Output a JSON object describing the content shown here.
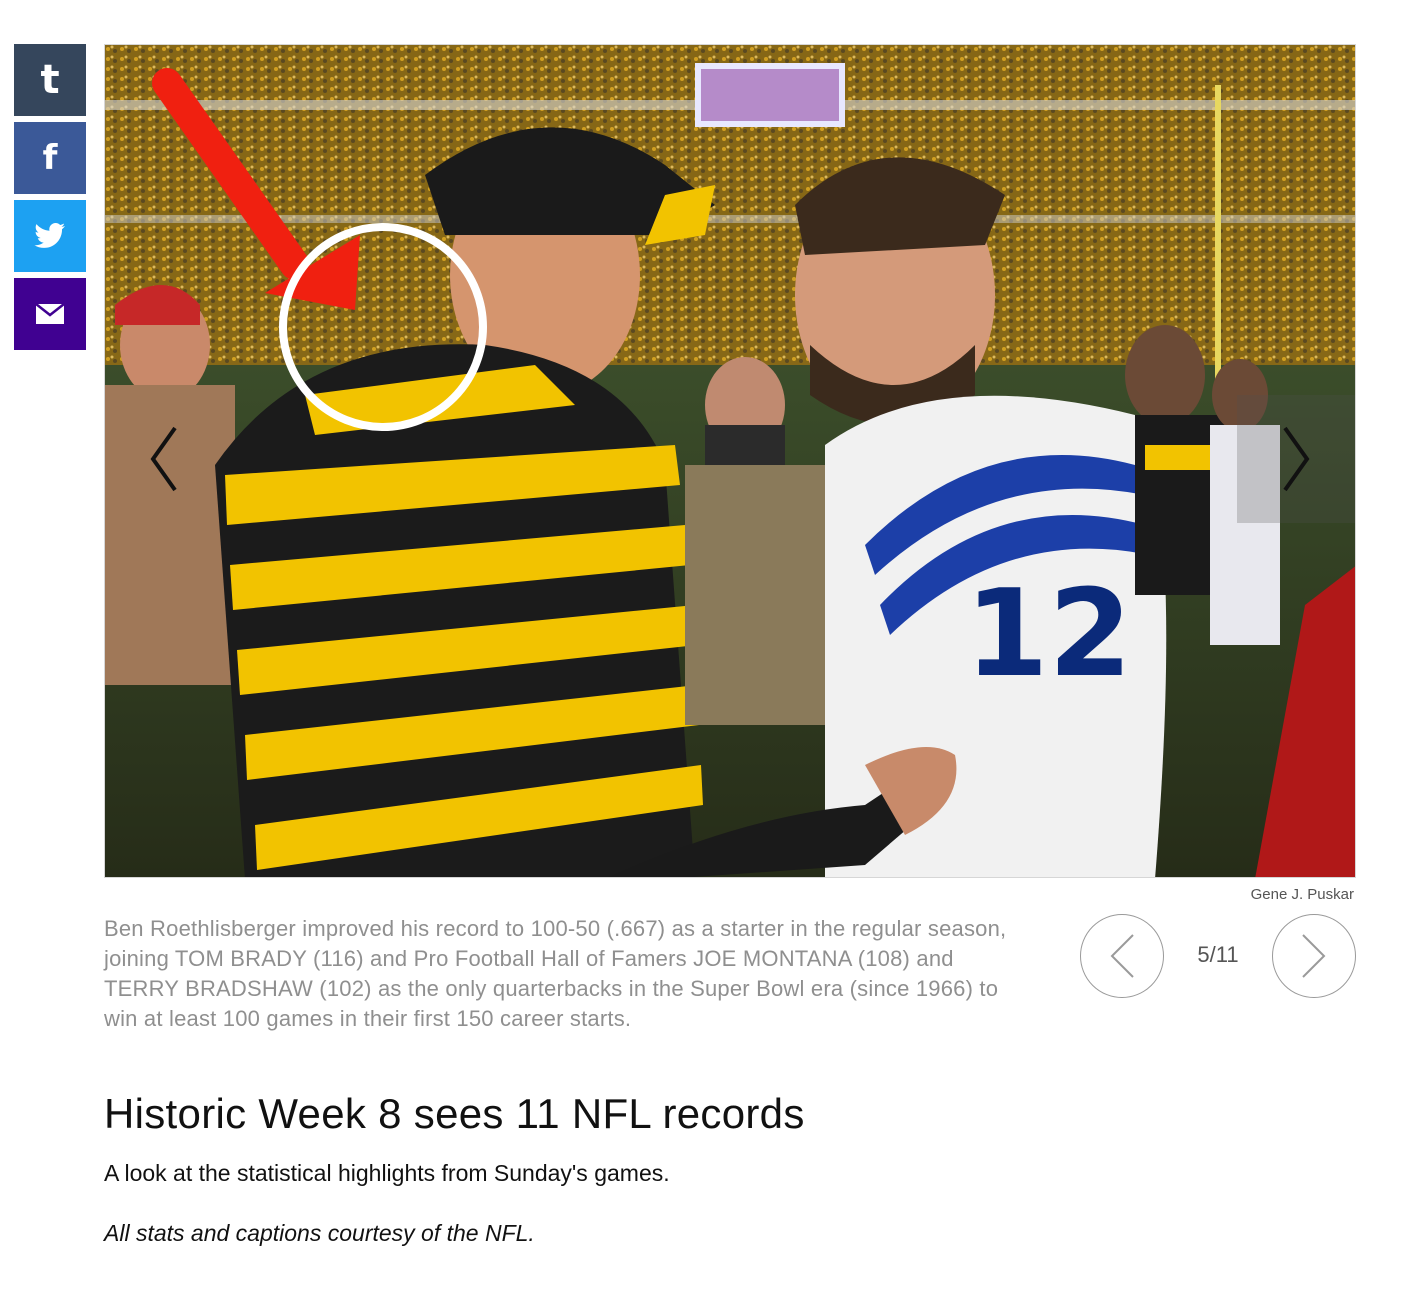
{
  "share": {
    "tumblr_glyph": "t",
    "facebook_glyph": "f",
    "twitter_icon": "twitter-bird-icon",
    "email_icon": "envelope-icon",
    "colors": {
      "tumblr": "#35465c",
      "facebook": "#3b5998",
      "twitter": "#1da1f2",
      "email": "#400191"
    }
  },
  "slideshow": {
    "photo_credit": "Gene J. Puskar",
    "jersey_number": "12",
    "prev_icon": "chevron-left-icon",
    "next_icon": "chevron-right-icon"
  },
  "caption": "Ben Roethlisberger improved his record to 100-50 (.667) as a starter in the regular season, joining TOM BRADY (116) and Pro Football Hall of Famers JOE MONTANA (108) and TERRY BRADSHAW (102) as the only quarterbacks in the Super Bowl era (since 1966) to win at least 100 games in their first 150 career starts.",
  "pager": {
    "counter": "5/11",
    "prev_icon": "chevron-left-icon",
    "next_icon": "chevron-right-icon"
  },
  "article": {
    "headline": "Historic Week 8 sees 11 NFL records",
    "dek": "A look at the statistical highlights from Sunday's games.",
    "courtesy": "All stats and captions courtesy of the NFL."
  }
}
